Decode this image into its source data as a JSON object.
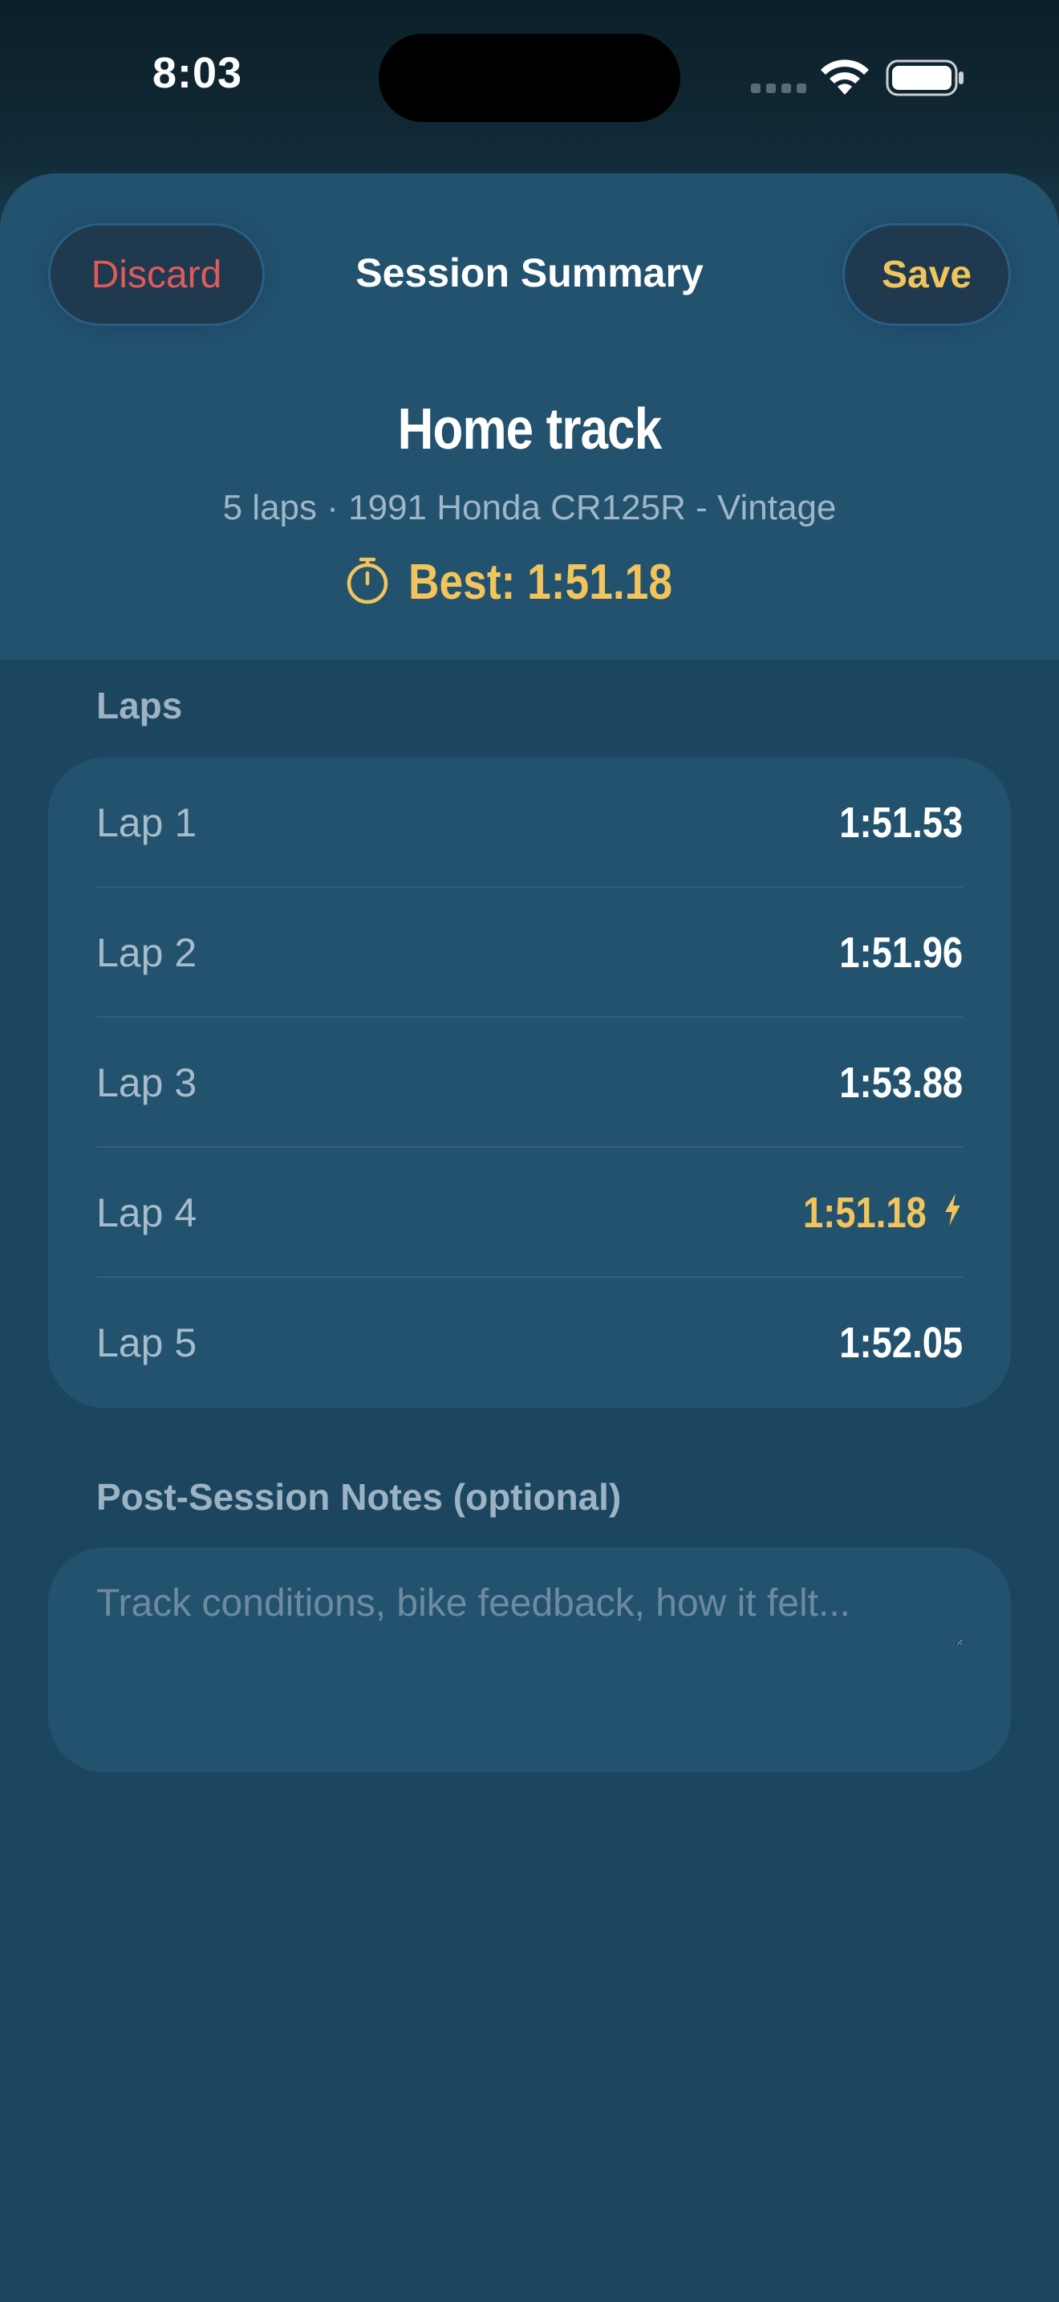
{
  "status_bar": {
    "time": "8:03"
  },
  "header": {
    "discard_label": "Discard",
    "title": "Session Summary",
    "save_label": "Save"
  },
  "session": {
    "track": "Home track",
    "meta": "5 laps · 1991 Honda CR125R - Vintage",
    "best": "Best: 1:51.18"
  },
  "laps_section": {
    "label": "Laps",
    "items": [
      {
        "label": "Lap 1",
        "time": "1:51.53",
        "is_best": false
      },
      {
        "label": "Lap 2",
        "time": "1:51.96",
        "is_best": false
      },
      {
        "label": "Lap 3",
        "time": "1:53.88",
        "is_best": false
      },
      {
        "label": "Lap 4",
        "time": "1:51.18",
        "is_best": true
      },
      {
        "label": "Lap 5",
        "time": "1:52.05",
        "is_best": false
      }
    ]
  },
  "notes": {
    "label": "Post-Session Notes (optional)",
    "placeholder": "Track conditions, bike feedback, how it felt...",
    "value": ""
  },
  "icons": {
    "best_time": "stopwatch-icon",
    "best_lap": "bolt-icon",
    "wifi": "wifi-icon",
    "battery": "battery-icon",
    "signal": "cellular-signal-icon"
  },
  "colors": {
    "accent_gold": "#f1c45c",
    "discard_red": "#e05a5a",
    "sheet_bg": "#1c4660",
    "card_bg": "#23526f"
  }
}
